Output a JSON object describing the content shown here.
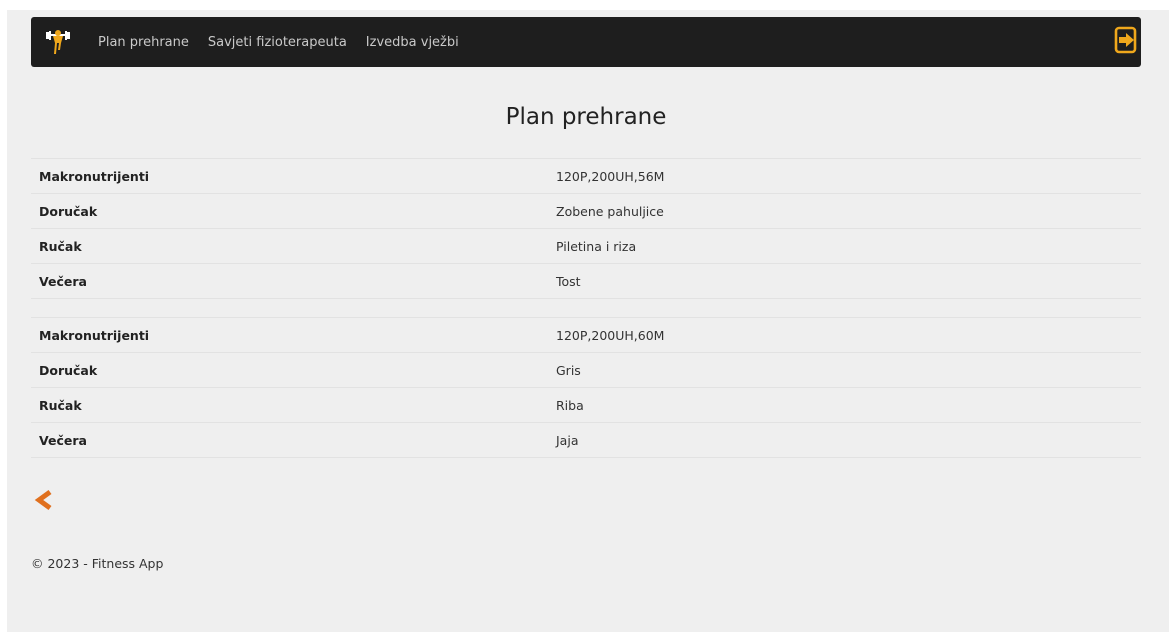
{
  "navbar": {
    "brand_icon": "fitness-figure-logo-icon",
    "links": [
      {
        "label": "Plan prehrane"
      },
      {
        "label": "Savjeti fizioterapeuta"
      },
      {
        "label": "Izvedba vježbi"
      }
    ],
    "logout_icon": "sign-out-icon"
  },
  "main": {
    "title": "Plan prehrane",
    "plans": [
      {
        "rows": [
          {
            "label": "Makronutrijenti",
            "value": "120P,200UH,56M"
          },
          {
            "label": "Doručak",
            "value": "Zobene pahuljice"
          },
          {
            "label": "Ručak",
            "value": "Piletina i riza"
          },
          {
            "label": "Večera",
            "value": "Tost"
          }
        ]
      },
      {
        "rows": [
          {
            "label": "Makronutrijenti",
            "value": "120P,200UH,60M"
          },
          {
            "label": "Doručak",
            "value": "Gris"
          },
          {
            "label": "Ručak",
            "value": "Riba"
          },
          {
            "label": "Večera",
            "value": "Jaja"
          }
        ]
      }
    ],
    "back_icon": "chevron-left-icon"
  },
  "footer": {
    "text": "© 2023 - Fitness App"
  },
  "colors": {
    "navbar_bg": "#1e1e1e",
    "page_bg": "#efefef",
    "accent_orange": "#f0a81c",
    "back_orange": "#e0701e"
  }
}
